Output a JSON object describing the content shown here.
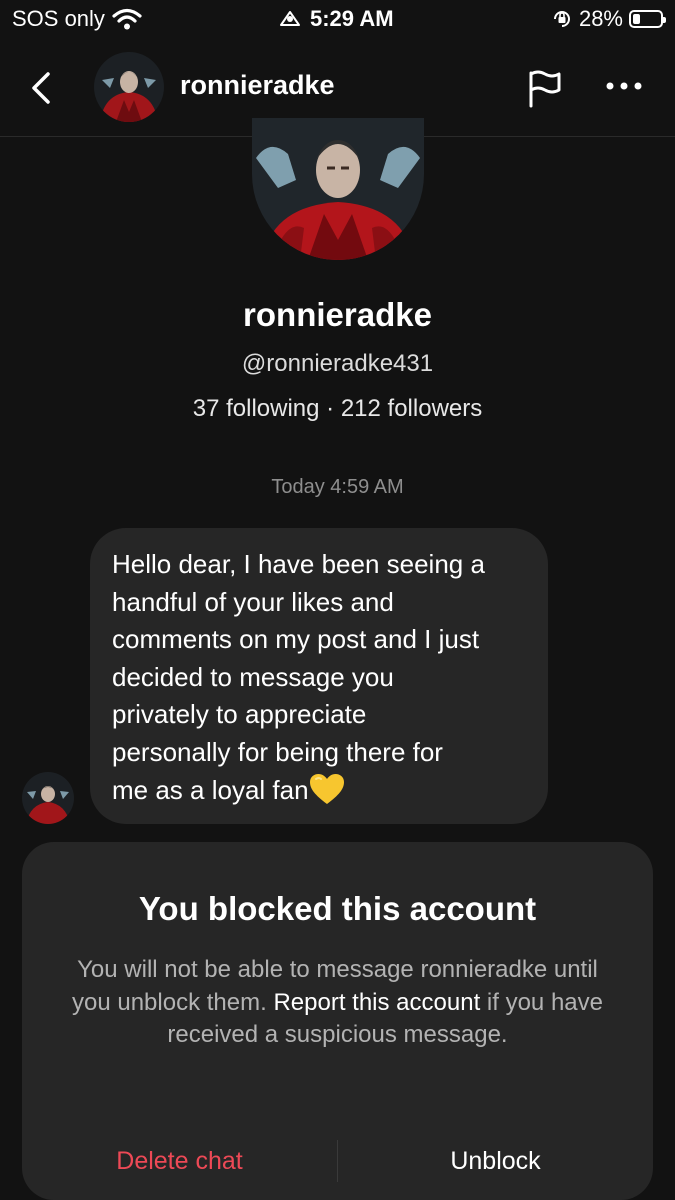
{
  "status_bar": {
    "carrier": "SOS only",
    "time": "5:29 AM",
    "battery": "28%",
    "battery_level": 0.28,
    "icons": [
      "wifi-icon",
      "screen-mirroring-icon",
      "orientation-lock-icon",
      "battery-icon"
    ]
  },
  "header": {
    "username": "ronnieradke",
    "icons": [
      "back-chevron-icon",
      "flag-icon",
      "more-dots-icon"
    ]
  },
  "profile": {
    "name": "ronnieradke",
    "handle": "@ronnieradke431",
    "stats": "37 following · 212 followers"
  },
  "chat": {
    "timestamp": "Today 4:59 AM",
    "message": {
      "lines": [
        "Hello dear, I have been seeing a",
        "handful of your likes and",
        "comments on my post and I just",
        "decided to message you",
        "privately to appreciate",
        "personally for being there for",
        "me as a loyal fan"
      ],
      "emoji": "yellow-heart-icon"
    }
  },
  "blocked_sheet": {
    "title": "You blocked this account",
    "body_part1": "You will not be able to message ronnieradke until you unblock them.",
    "report_link": "Report this account",
    "body_part2": "if you have received a suspicious message.",
    "delete_label": "Delete chat",
    "unblock_label": "Unblock",
    "colors": {
      "delete": "#ed4956",
      "sheet_bg": "#262626",
      "page_bg": "#121212"
    }
  }
}
